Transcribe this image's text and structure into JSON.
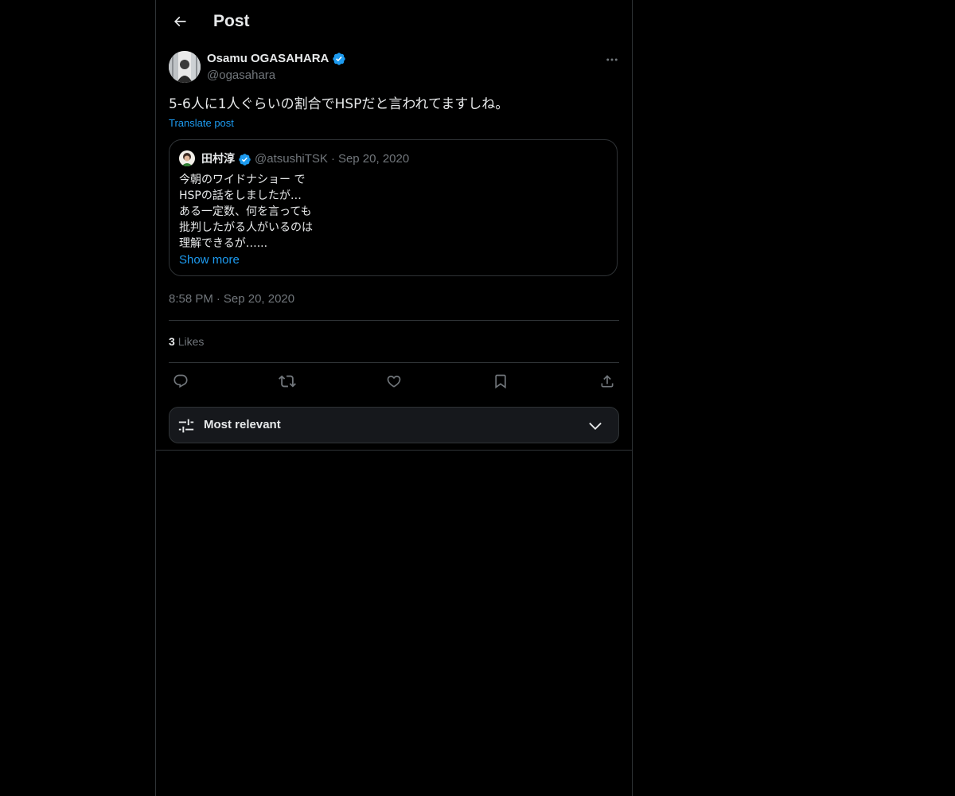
{
  "header": {
    "title": "Post",
    "back_icon": "arrow-left-icon"
  },
  "post": {
    "author": {
      "name": "Osamu OGASAHARA",
      "handle": "@ogasahara",
      "verified": true
    },
    "text": "5-6人に1人ぐらいの割合でHSPだと言われてますしね。",
    "translate_label": "Translate post",
    "quote": {
      "name": "田村淳",
      "handle": "@atsushiTSK",
      "separator": "·",
      "date": "Sep 20, 2020",
      "lines": [
        "今朝のワイドナショー で",
        "HSPの話をしましたが…",
        "ある一定数、何を言っても",
        "批判したがる人がいるのは",
        "理解できるが…..."
      ],
      "show_more": "Show more"
    },
    "time": "8:58 PM",
    "time_separator": "·",
    "date": "Sep 20, 2020",
    "likes_count": "3",
    "likes_label": "Likes"
  },
  "actions": [
    {
      "name": "reply",
      "icon": "reply-icon"
    },
    {
      "name": "repost",
      "icon": "repost-icon"
    },
    {
      "name": "like",
      "icon": "heart-icon"
    },
    {
      "name": "bookmark",
      "icon": "bookmark-icon"
    },
    {
      "name": "share",
      "icon": "share-icon"
    }
  ],
  "sort": {
    "label": "Most relevant",
    "icon": "sliders-icon",
    "chevron": "chevron-down-icon"
  },
  "colors": {
    "background": "#000000",
    "text": "#e7e9ea",
    "muted": "#71767b",
    "accent": "#1d9bf0",
    "border": "#2f3336"
  }
}
